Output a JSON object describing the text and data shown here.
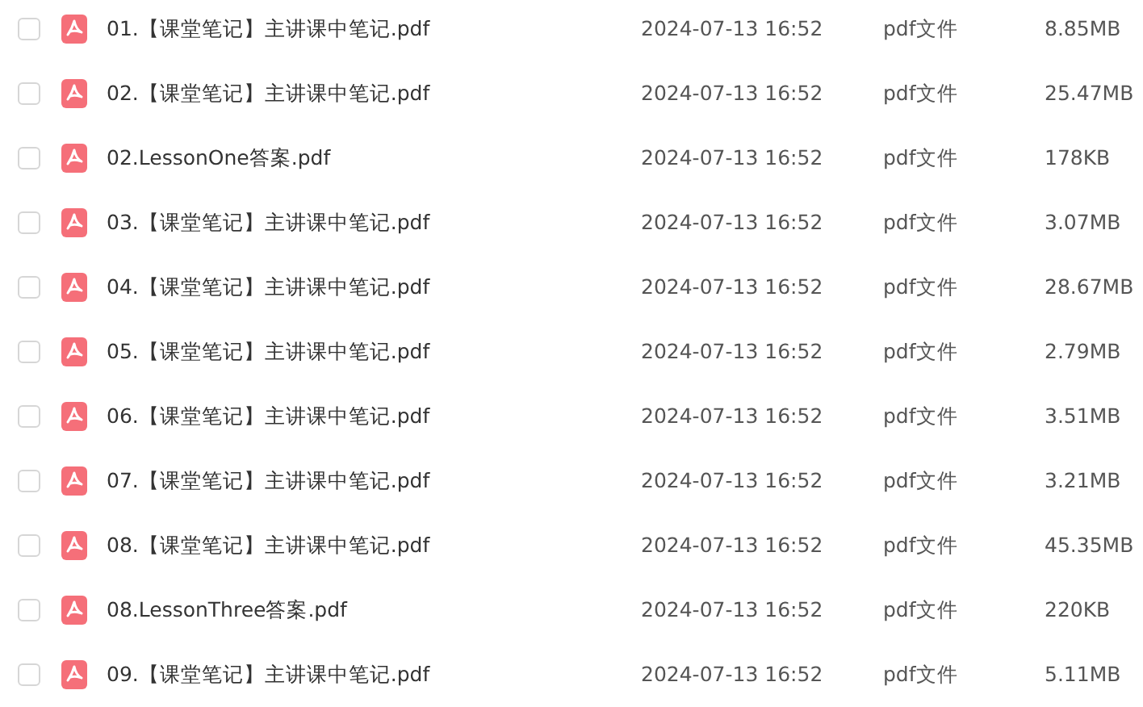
{
  "files": [
    {
      "name": "01.【课堂笔记】主讲课中笔记.pdf",
      "date": "2024-07-13 16:52",
      "type": "pdf文件",
      "size": "8.85MB",
      "checked": false
    },
    {
      "name": "02.【课堂笔记】主讲课中笔记.pdf",
      "date": "2024-07-13 16:52",
      "type": "pdf文件",
      "size": "25.47MB",
      "checked": false
    },
    {
      "name": "02.LessonOne答案.pdf",
      "date": "2024-07-13 16:52",
      "type": "pdf文件",
      "size": "178KB",
      "checked": false
    },
    {
      "name": "03.【课堂笔记】主讲课中笔记.pdf",
      "date": "2024-07-13 16:52",
      "type": "pdf文件",
      "size": "3.07MB",
      "checked": false
    },
    {
      "name": "04.【课堂笔记】主讲课中笔记.pdf",
      "date": "2024-07-13 16:52",
      "type": "pdf文件",
      "size": "28.67MB",
      "checked": false
    },
    {
      "name": "05.【课堂笔记】主讲课中笔记.pdf",
      "date": "2024-07-13 16:52",
      "type": "pdf文件",
      "size": "2.79MB",
      "checked": false
    },
    {
      "name": "06.【课堂笔记】主讲课中笔记.pdf",
      "date": "2024-07-13 16:52",
      "type": "pdf文件",
      "size": "3.51MB",
      "checked": false
    },
    {
      "name": "07.【课堂笔记】主讲课中笔记.pdf",
      "date": "2024-07-13 16:52",
      "type": "pdf文件",
      "size": "3.21MB",
      "checked": false
    },
    {
      "name": "08.【课堂笔记】主讲课中笔记.pdf",
      "date": "2024-07-13 16:52",
      "type": "pdf文件",
      "size": "45.35MB",
      "checked": false
    },
    {
      "name": "08.LessonThree答案.pdf",
      "date": "2024-07-13 16:52",
      "type": "pdf文件",
      "size": "220KB",
      "checked": false
    },
    {
      "name": "09.【课堂笔记】主讲课中笔记.pdf",
      "date": "2024-07-13 16:52",
      "type": "pdf文件",
      "size": "5.11MB",
      "checked": false
    }
  ]
}
